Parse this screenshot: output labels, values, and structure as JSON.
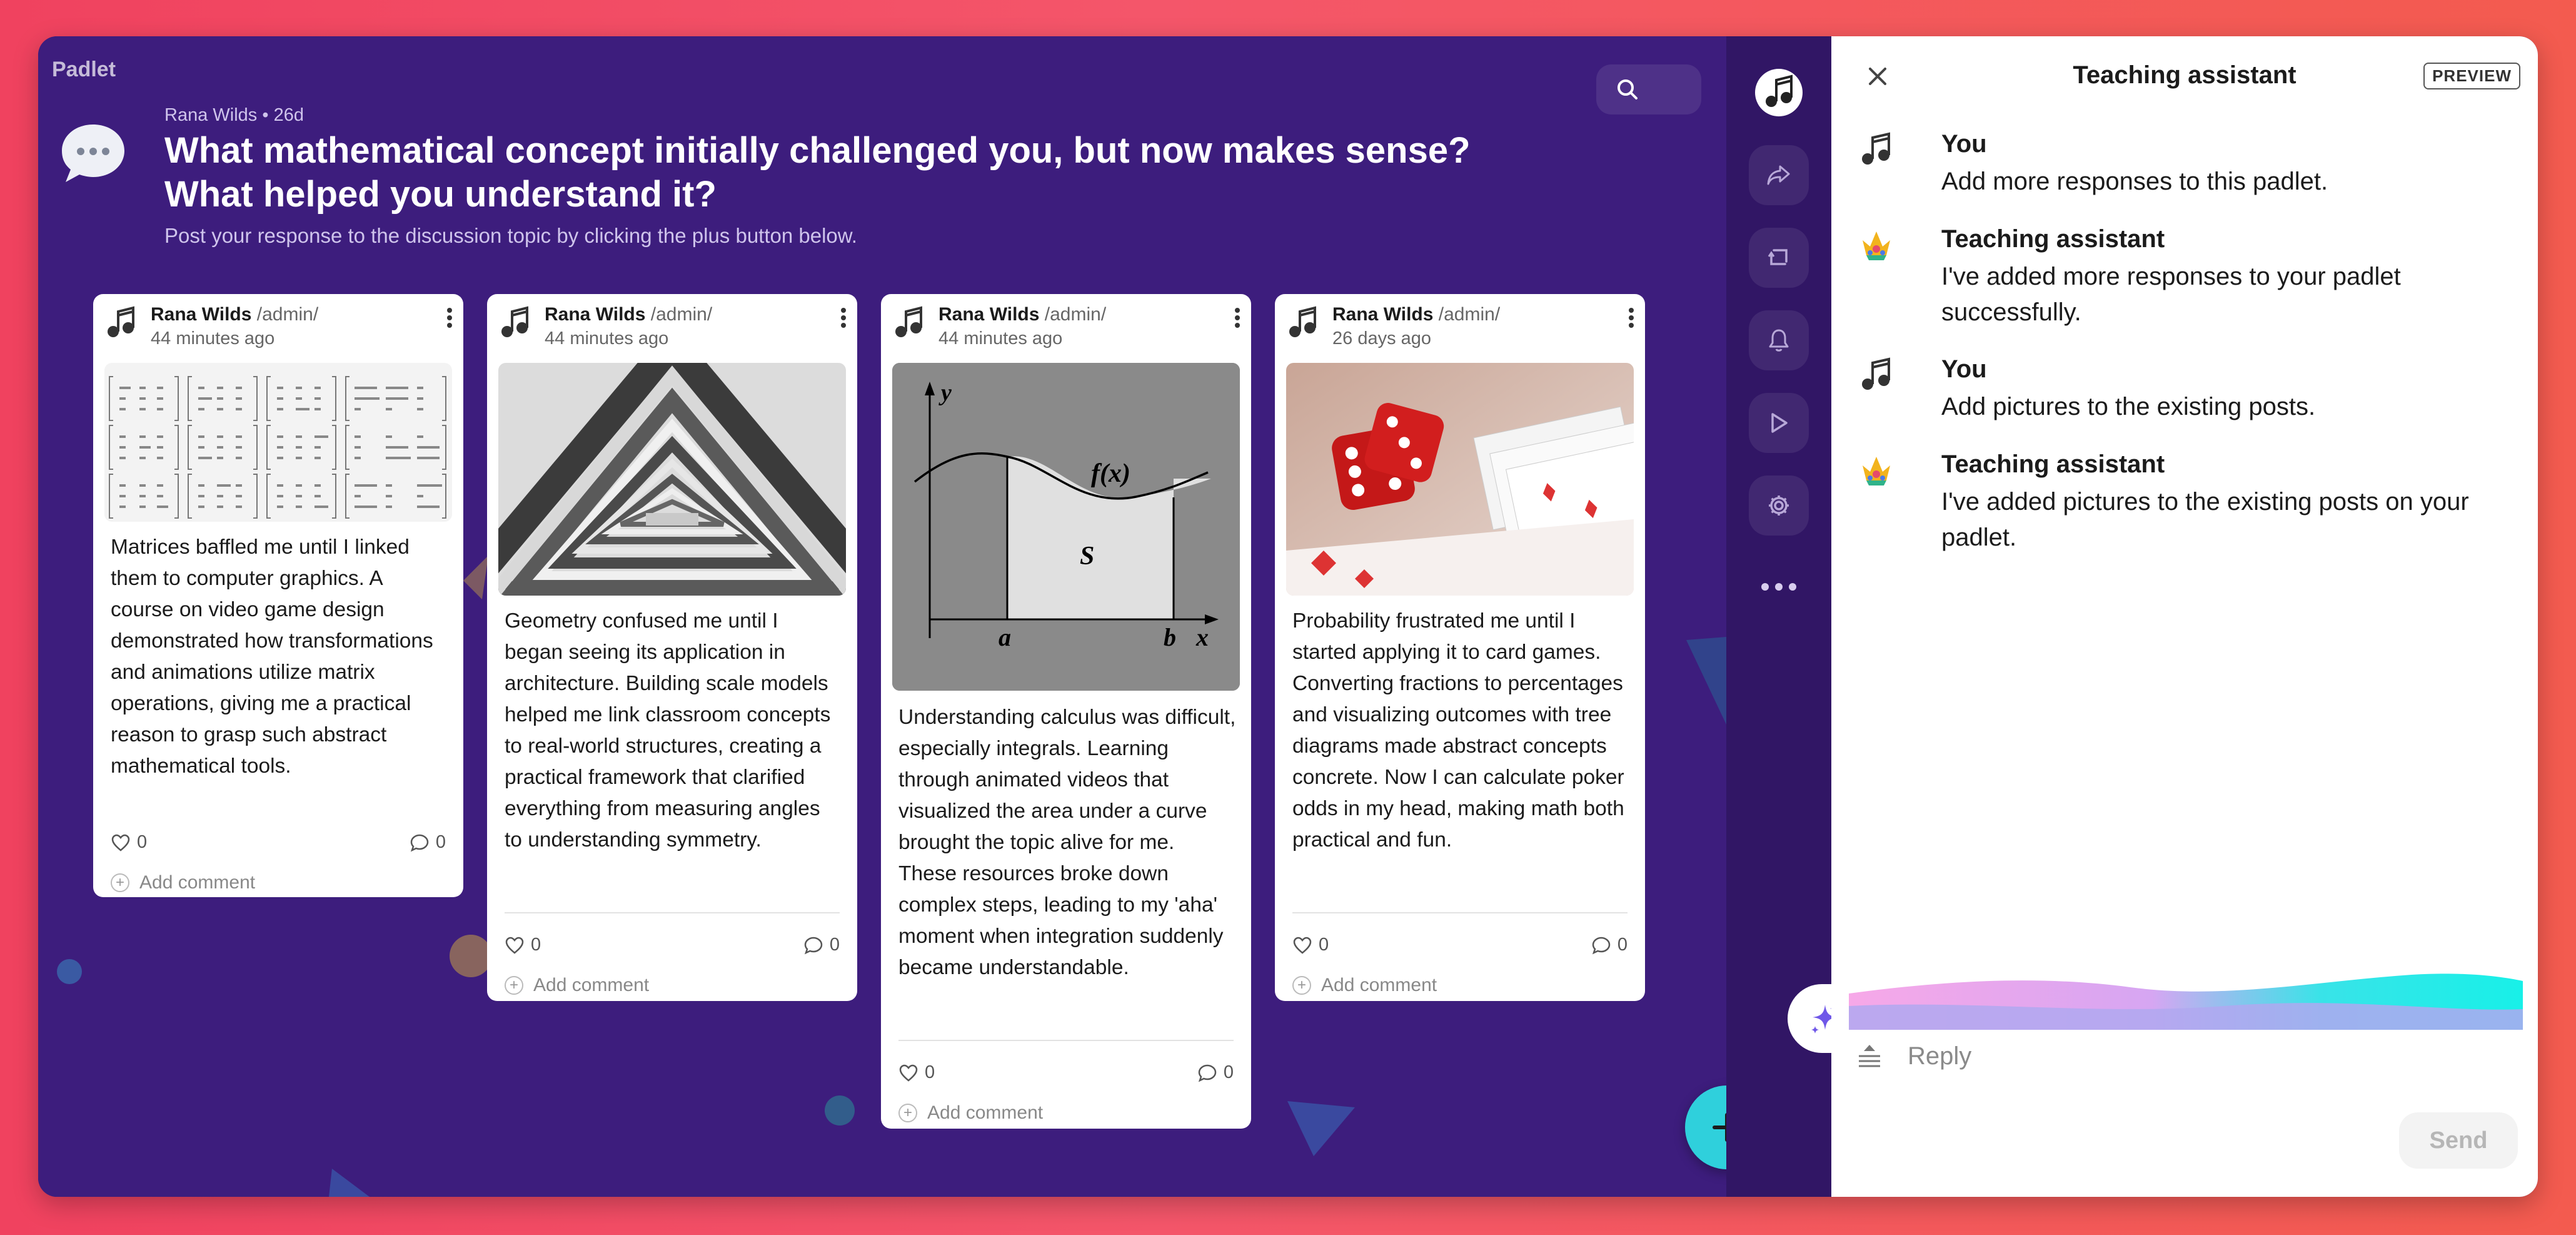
{
  "board": {
    "brand": "Padlet",
    "author": "Rana Wilds",
    "age": "26d",
    "title": "What mathematical concept initially challenged you, but now makes sense? What helped you understand it?",
    "subtitle": "Post your response to the discussion topic by clicking the plus button below."
  },
  "posts": [
    {
      "author": "Rana Wilds",
      "role": "/admin/",
      "time": "44 minutes ago",
      "body": "Matrices baffled me until I linked them to computer graphics. A course on video game design demonstrated how transformations and animations utilize matrix operations, giving me a practical reason to grasp such abstract mathematical tools.",
      "likes": "0",
      "comments": "0",
      "add_comment": "Add comment"
    },
    {
      "author": "Rana Wilds",
      "role": "/admin/",
      "time": "44 minutes ago",
      "body": "Geometry confused me until I began seeing its application in architecture. Building scale models helped me link classroom concepts to real-world structures, creating a practical framework that clarified everything from measuring angles to understanding symmetry.",
      "likes": "0",
      "comments": "0",
      "add_comment": "Add comment"
    },
    {
      "author": "Rana Wilds",
      "role": "/admin/",
      "time": "44 minutes ago",
      "body": "Understanding calculus was difficult, especially integrals. Learning through animated videos that visualized the area under a curve brought the topic alive for me. These resources broke down complex steps, leading to my 'aha' moment when integration suddenly became understandable.",
      "likes": "0",
      "comments": "0",
      "add_comment": "Add comment",
      "figure": {
        "y": "y",
        "fx": "f(x)",
        "s": "S",
        "a": "a",
        "b": "b",
        "x": "x"
      }
    },
    {
      "author": "Rana Wilds",
      "role": "/admin/",
      "time": "26 days ago",
      "body": "Probability frustrated me until I started applying it to card games. Converting fractions to percentages and visualizing outcomes with tree diagrams made abstract concepts concrete. Now I can calculate poker odds in my head, making math both practical and fun.",
      "likes": "0",
      "comments": "0",
      "add_comment": "Add comment"
    }
  ],
  "assistant": {
    "title": "Teaching assistant",
    "badge": "PREVIEW",
    "messages": [
      {
        "name": "You",
        "text": "Add more responses to this padlet."
      },
      {
        "name": "Teaching assistant",
        "text": "I've added more responses to your padlet successfully."
      },
      {
        "name": "You",
        "text": "Add pictures to the existing posts."
      },
      {
        "name": "Teaching assistant",
        "text": "I've added pictures to the existing posts on your padlet."
      }
    ],
    "reply_placeholder": "Reply",
    "send_label": "Send"
  },
  "colors": {
    "board_bg": "#3d1d7d",
    "rail_bg": "#311665",
    "fab": "#2fd0dc",
    "page_gradient_start": "#f0425f",
    "page_gradient_end": "#f35b4f"
  },
  "icons": {
    "rail": [
      "avatar-icon",
      "share-icon",
      "remake-icon",
      "bell-icon",
      "slideshow-icon",
      "settings-icon",
      "more-icon"
    ],
    "fab": "plus-icon",
    "panel": [
      "close-icon",
      "sparkle-icon",
      "reply-icon"
    ]
  }
}
